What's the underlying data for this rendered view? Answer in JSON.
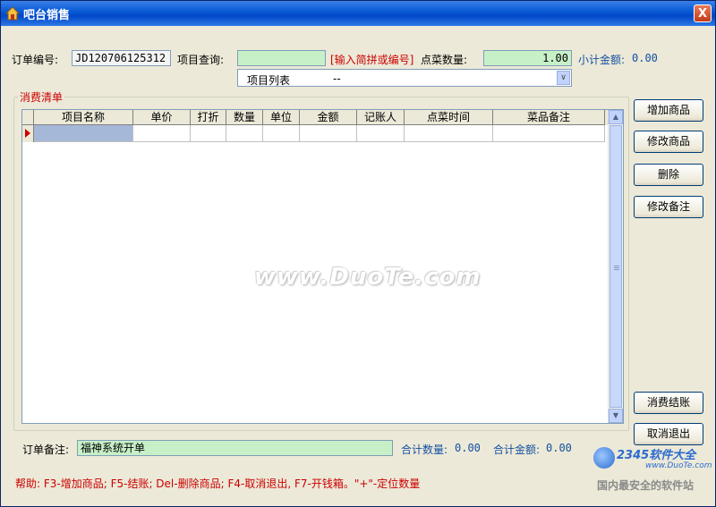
{
  "window": {
    "title": "吧台销售",
    "close_glyph": "X"
  },
  "order": {
    "order_no_label": "订单编号:",
    "order_no_value": "JD120706125312",
    "query_label": "项目查询:",
    "query_value": "",
    "query_hint": "[输入简拼或编号]",
    "qty_label": "点菜数量:",
    "qty_value": "1.00",
    "subtotal_label": "小计金额:",
    "subtotal_value": "0.00",
    "item_list_caption": "项目列表",
    "item_list_value": "--"
  },
  "list": {
    "group_title": "消费清单",
    "columns": [
      "项目名称",
      "单价",
      "打折",
      "数量",
      "单位",
      "金额",
      "记账人",
      "点菜时间",
      "菜品备注"
    ]
  },
  "watermark": "www.DuoTe.com",
  "buttons": {
    "add": "增加商品",
    "edit": "修改商品",
    "delete": "删除",
    "edit_note": "修改备注",
    "checkout": "消费结账",
    "cancel": "取消退出"
  },
  "footer": {
    "note_label": "订单备注:",
    "note_value": "福神系统开单",
    "total_qty_label": "合计数量:",
    "total_qty_value": "0.00",
    "total_amount_label": "合计金额:",
    "total_amount_value": "0.00",
    "help": "帮助: F3-增加商品; F5-结账; Del-删除商品; F4-取消退出, F7-开钱箱。\"+\"-定位数量"
  },
  "site_logo": {
    "title": "2345软件大全",
    "site": "www.DuoTe.com",
    "caption": "国内最安全的软件站"
  }
}
